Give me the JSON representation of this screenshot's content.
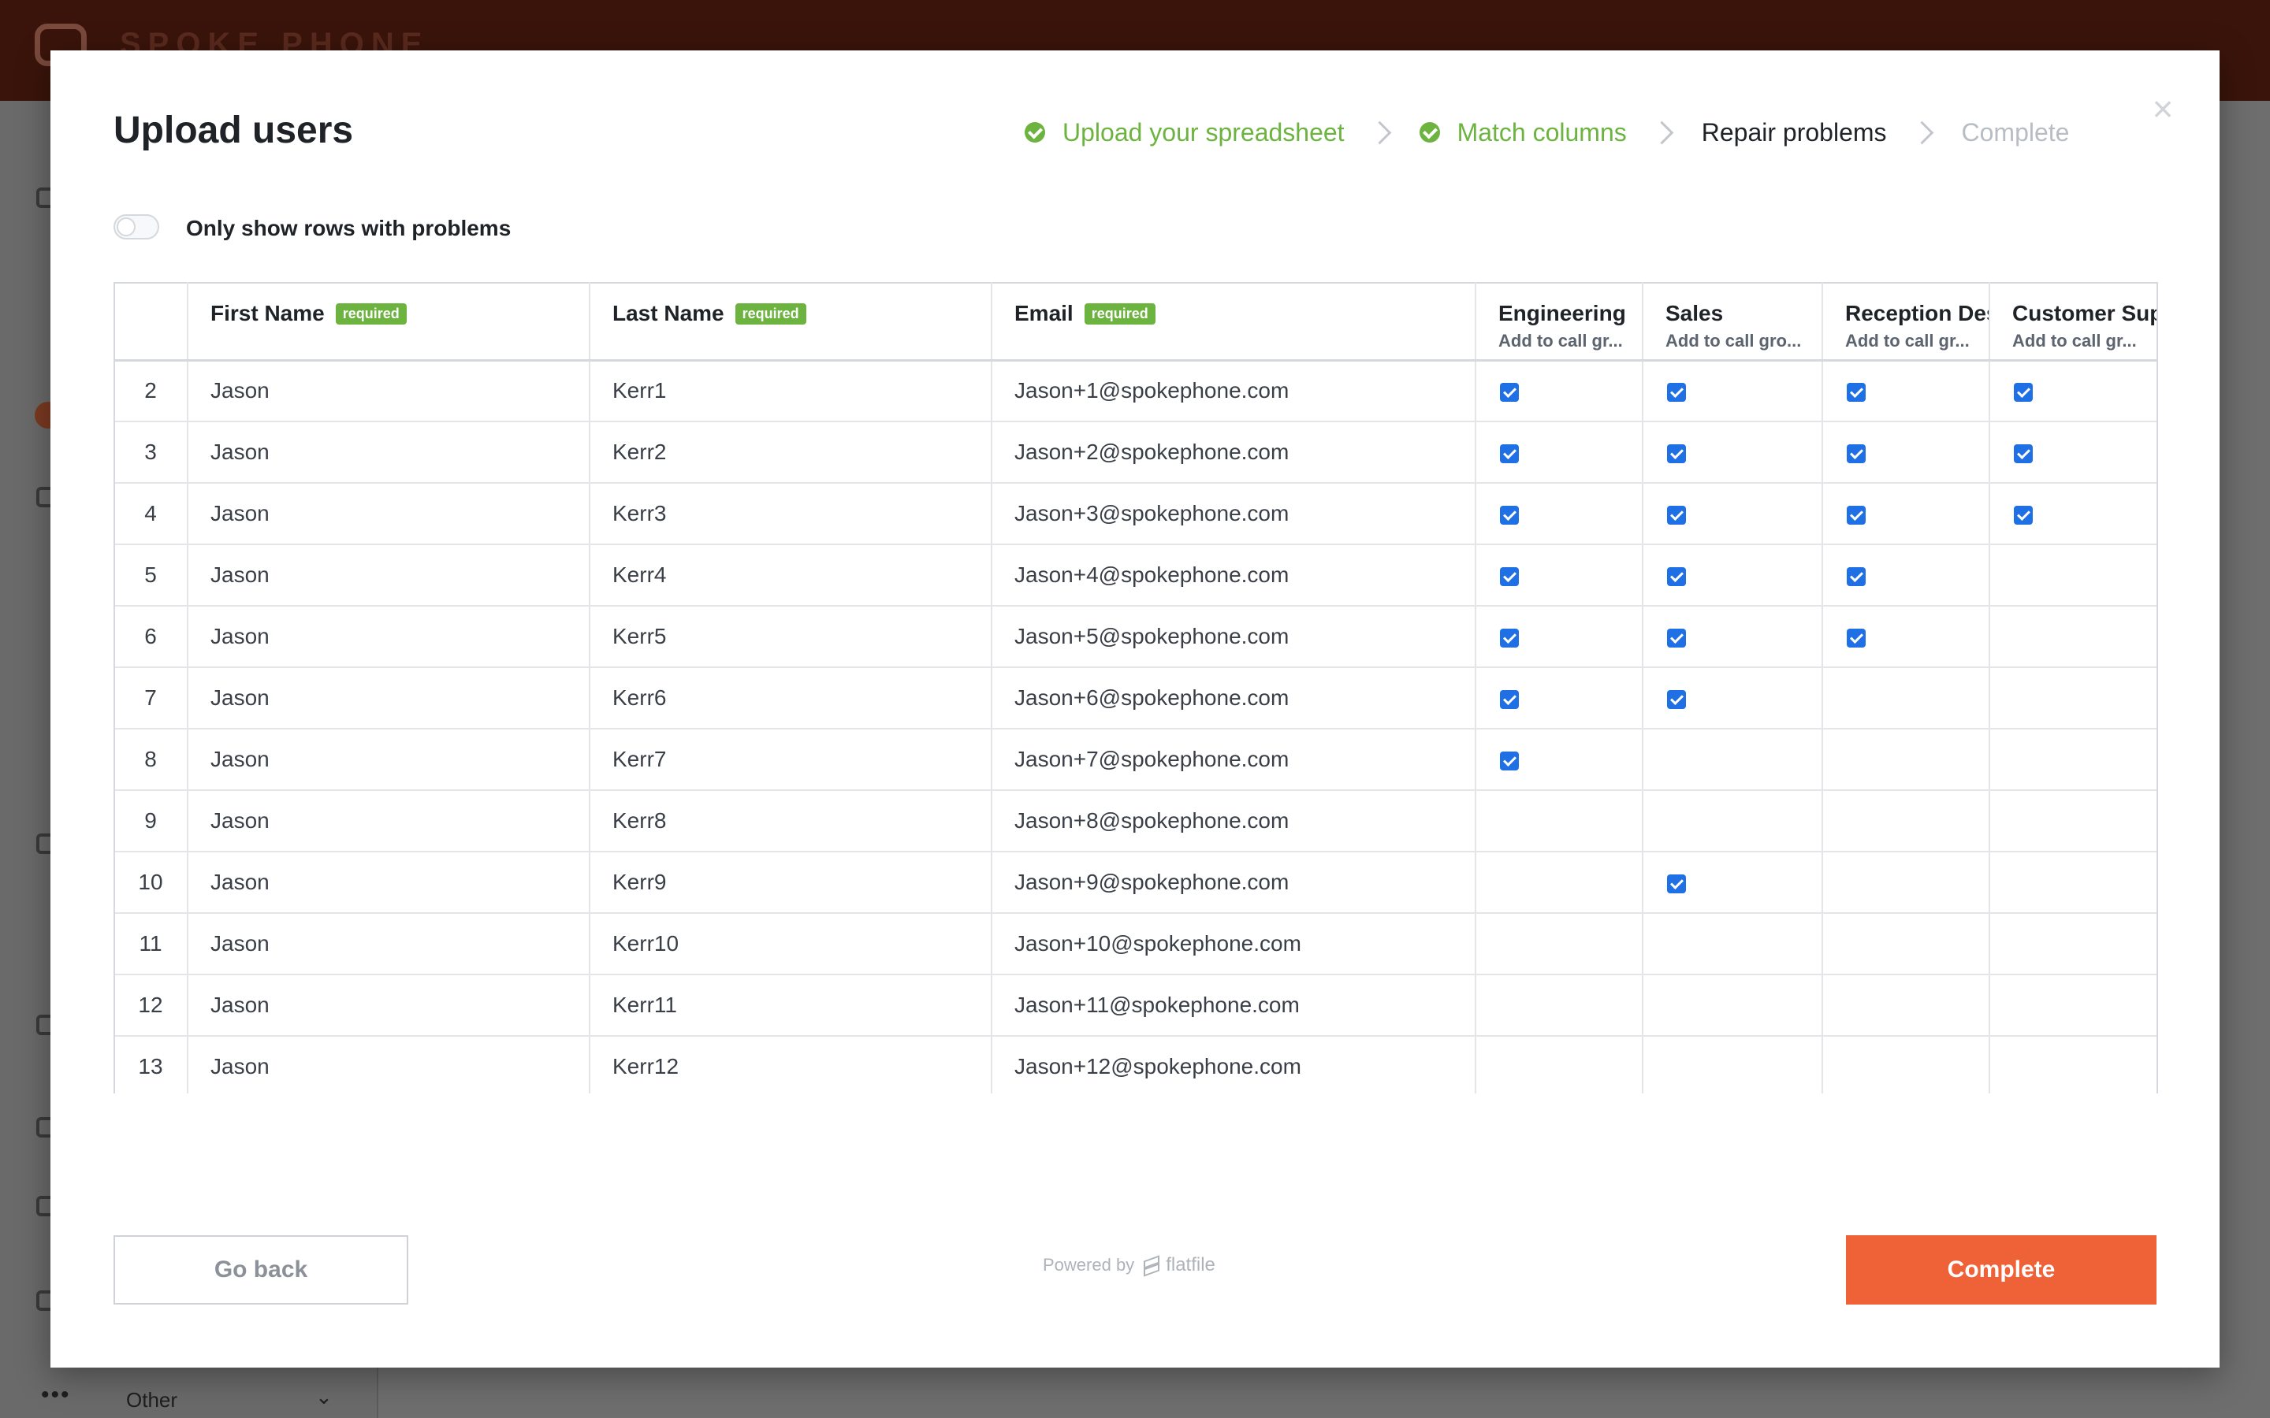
{
  "app": {
    "logo_text": "SPOKE PHONE",
    "sidebar_other": "Other"
  },
  "modal": {
    "title": "Upload users",
    "steps": [
      {
        "label": "Upload your spreadsheet",
        "state": "done"
      },
      {
        "label": "Match columns",
        "state": "done"
      },
      {
        "label": "Repair problems",
        "state": "current"
      },
      {
        "label": "Complete",
        "state": "todo"
      }
    ],
    "toggle_label": "Only show rows with problems",
    "toggle_on": false
  },
  "table": {
    "columns": [
      {
        "key": "idx",
        "name": "",
        "badge": "",
        "sub": ""
      },
      {
        "key": "first",
        "name": "First Name",
        "badge": "required",
        "sub": ""
      },
      {
        "key": "last",
        "name": "Last Name",
        "badge": "required",
        "sub": ""
      },
      {
        "key": "email",
        "name": "Email",
        "badge": "required",
        "sub": ""
      },
      {
        "key": "engineering",
        "name": "Engineering",
        "badge": "",
        "sub": "Add to call gr..."
      },
      {
        "key": "sales",
        "name": "Sales",
        "badge": "",
        "sub": "Add to call gro..."
      },
      {
        "key": "reception",
        "name": "Reception Des",
        "badge": "",
        "sub": "Add to call gr..."
      },
      {
        "key": "support",
        "name": "Customer Sup",
        "badge": "",
        "sub": "Add to call gr..."
      }
    ],
    "rows": [
      {
        "idx": "2",
        "first": "Jason",
        "last": "Kerr1",
        "email": "Jason+1@spokephone.com",
        "engineering": true,
        "sales": true,
        "reception": true,
        "support": true
      },
      {
        "idx": "3",
        "first": "Jason",
        "last": "Kerr2",
        "email": "Jason+2@spokephone.com",
        "engineering": true,
        "sales": true,
        "reception": true,
        "support": true
      },
      {
        "idx": "4",
        "first": "Jason",
        "last": "Kerr3",
        "email": "Jason+3@spokephone.com",
        "engineering": true,
        "sales": true,
        "reception": true,
        "support": true
      },
      {
        "idx": "5",
        "first": "Jason",
        "last": "Kerr4",
        "email": "Jason+4@spokephone.com",
        "engineering": true,
        "sales": true,
        "reception": true,
        "support": false
      },
      {
        "idx": "6",
        "first": "Jason",
        "last": "Kerr5",
        "email": "Jason+5@spokephone.com",
        "engineering": true,
        "sales": true,
        "reception": true,
        "support": false
      },
      {
        "idx": "7",
        "first": "Jason",
        "last": "Kerr6",
        "email": "Jason+6@spokephone.com",
        "engineering": true,
        "sales": true,
        "reception": false,
        "support": false
      },
      {
        "idx": "8",
        "first": "Jason",
        "last": "Kerr7",
        "email": "Jason+7@spokephone.com",
        "engineering": true,
        "sales": false,
        "reception": false,
        "support": false
      },
      {
        "idx": "9",
        "first": "Jason",
        "last": "Kerr8",
        "email": "Jason+8@spokephone.com",
        "engineering": false,
        "sales": false,
        "reception": false,
        "support": false
      },
      {
        "idx": "10",
        "first": "Jason",
        "last": "Kerr9",
        "email": "Jason+9@spokephone.com",
        "engineering": false,
        "sales": true,
        "reception": false,
        "support": false
      },
      {
        "idx": "11",
        "first": "Jason",
        "last": "Kerr10",
        "email": "Jason+10@spokephone.com",
        "engineering": false,
        "sales": false,
        "reception": false,
        "support": false
      },
      {
        "idx": "12",
        "first": "Jason",
        "last": "Kerr11",
        "email": "Jason+11@spokephone.com",
        "engineering": false,
        "sales": false,
        "reception": false,
        "support": false
      },
      {
        "idx": "13",
        "first": "Jason",
        "last": "Kerr12",
        "email": "Jason+12@spokephone.com",
        "engineering": false,
        "sales": false,
        "reception": false,
        "support": false
      }
    ]
  },
  "footer": {
    "back_label": "Go back",
    "powered_by": "Powered by",
    "brand": "flatfile",
    "complete_label": "Complete"
  },
  "colors": {
    "accent": "#ef6137",
    "success": "#6cb33f",
    "checkbox": "#1f6fe5"
  },
  "icons": {
    "close": "close-icon",
    "step_done": "check-circle-icon",
    "step_separator": "chevron-right-icon",
    "brand": "flatfile-logo-icon"
  }
}
